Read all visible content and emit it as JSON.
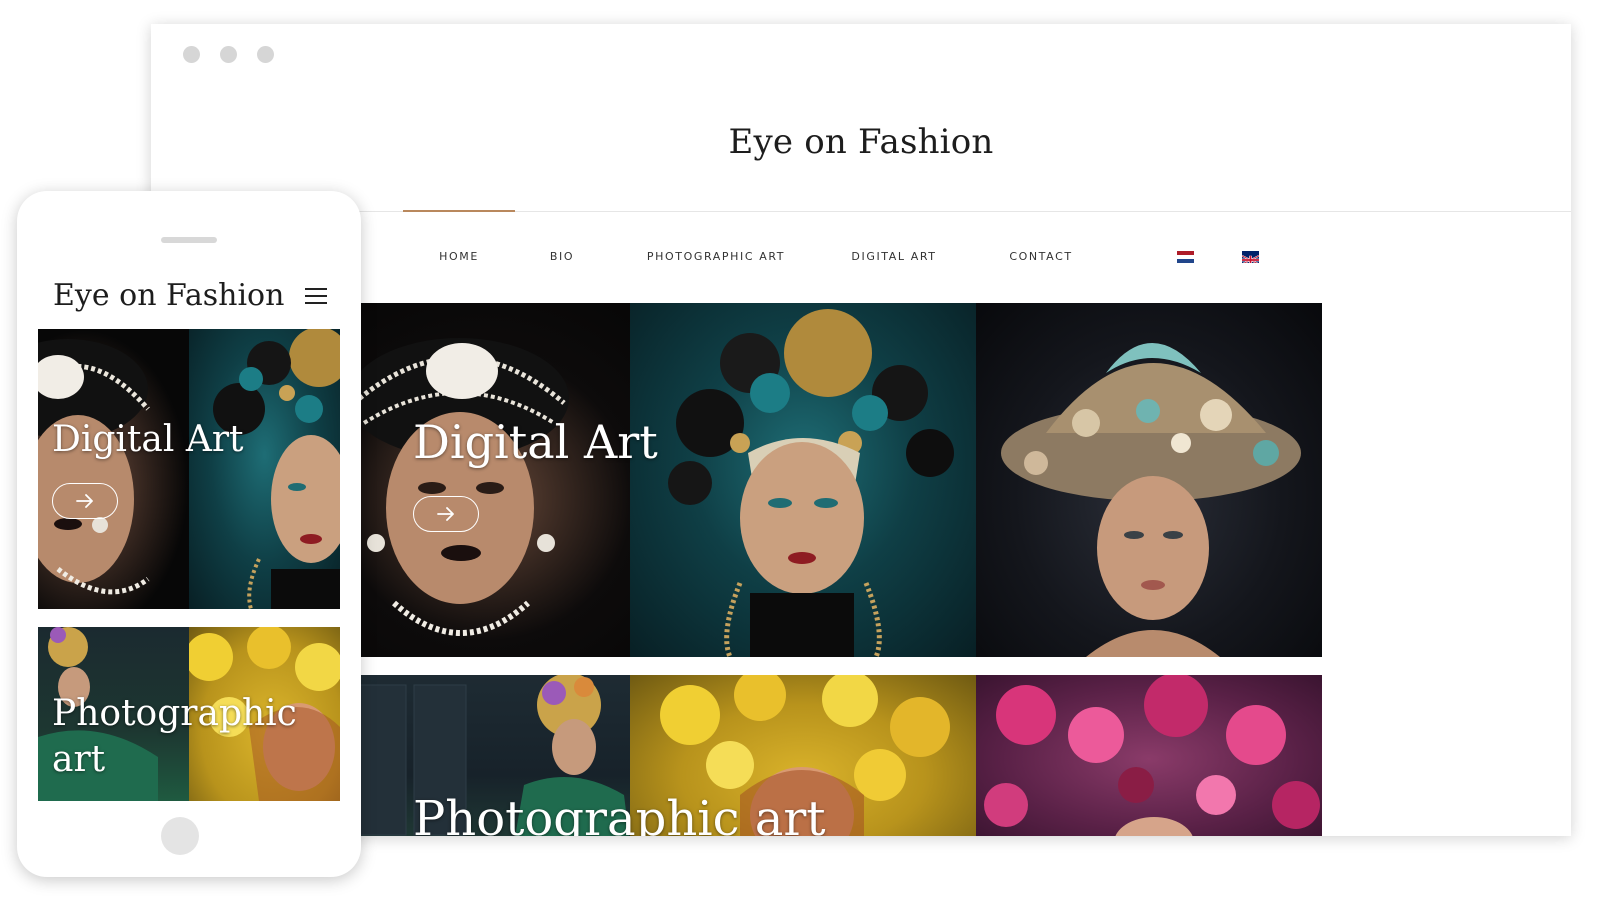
{
  "desktop": {
    "site_title": "Eye on Fashion",
    "nav": [
      {
        "label": "HOME",
        "active": true
      },
      {
        "label": "BIO",
        "active": false
      },
      {
        "label": "PHOTOGRAPHIC ART",
        "active": false
      },
      {
        "label": "DIGITAL ART",
        "active": false
      },
      {
        "label": "CONTACT",
        "active": false
      }
    ],
    "languages": [
      "nl-flag-icon",
      "uk-flag-icon"
    ],
    "tiles": {
      "digital_art": {
        "title": "Digital Art",
        "button_icon": "arrow-right-icon"
      },
      "photographic_art": {
        "title": "Photographic art"
      }
    }
  },
  "mobile": {
    "site_title": "Eye on Fashion",
    "menu_icon": "hamburger-icon",
    "tiles": {
      "digital_art": {
        "title": "Digital Art",
        "button_icon": "arrow-right-icon"
      },
      "photographic_art": {
        "title": "Photographic art"
      }
    }
  },
  "colors": {
    "accent": "#b9885d",
    "text": "#1d1d1d",
    "window_dots": "#d6d6d6"
  }
}
